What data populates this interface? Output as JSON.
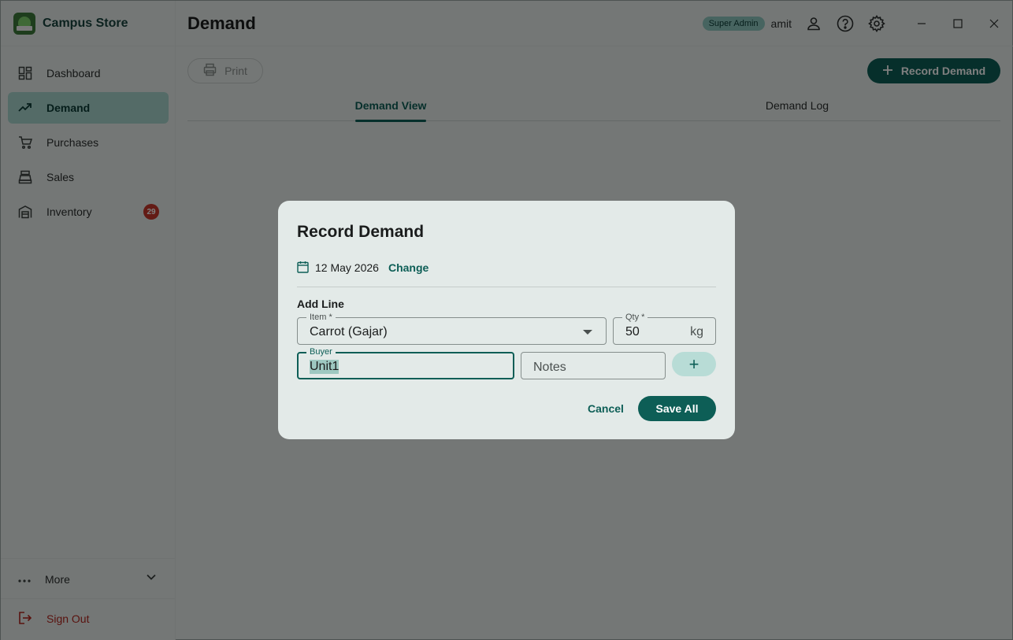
{
  "app": {
    "name": "Campus Store",
    "page_title": "Demand"
  },
  "header": {
    "role_badge": "Super Admin",
    "username": "amit"
  },
  "sidebar": {
    "items": [
      {
        "label": "Dashboard",
        "icon": "dashboard-icon",
        "active": false
      },
      {
        "label": "Demand",
        "icon": "trending-up-icon",
        "active": true
      },
      {
        "label": "Purchases",
        "icon": "cart-icon",
        "active": false
      },
      {
        "label": "Sales",
        "icon": "cash-register-icon",
        "active": false
      },
      {
        "label": "Inventory",
        "icon": "warehouse-icon",
        "active": false,
        "badge": "29"
      }
    ],
    "more_label": "More",
    "signout_label": "Sign Out"
  },
  "toolbar": {
    "print_label": "Print",
    "record_label": "Record Demand"
  },
  "tabs": [
    {
      "label": "Demand View",
      "active": true
    },
    {
      "label": "Demand Log",
      "active": false
    }
  ],
  "dialog": {
    "title": "Record Demand",
    "date": "12 May 2026",
    "change_label": "Change",
    "add_line_label": "Add Line",
    "item": {
      "label": "Item *",
      "value": "Carrot (Gajar)"
    },
    "qty": {
      "label": "Qty *",
      "value": "50",
      "unit": "kg"
    },
    "buyer": {
      "label": "Buyer",
      "value": "Unit1"
    },
    "notes": {
      "placeholder": "Notes"
    },
    "add_symbol": "+",
    "cancel_label": "Cancel",
    "save_label": "Save All"
  },
  "colors": {
    "primary": "#0d5e56",
    "active_nav": "#a8d6cf",
    "badge": "#c6362a",
    "signout": "#b3261e"
  }
}
